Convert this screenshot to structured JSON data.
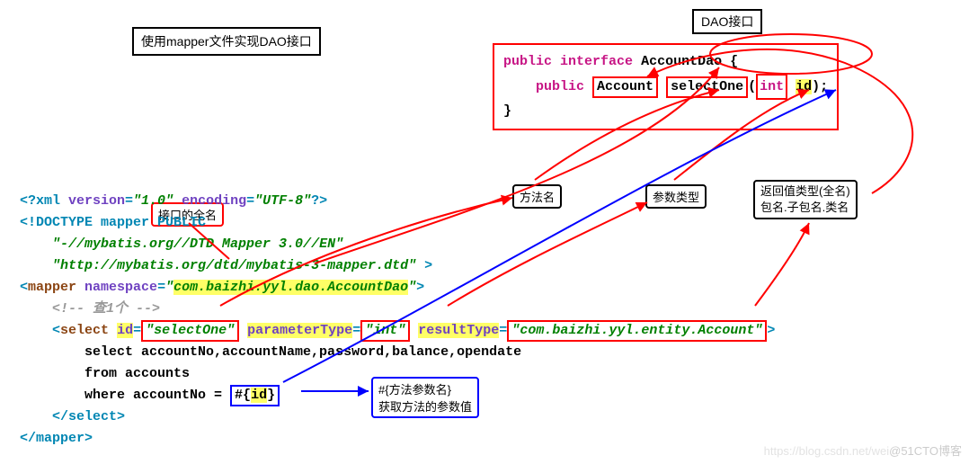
{
  "labels": {
    "top_title": "使用mapper文件实现DAO接口",
    "dao_title": "DAO接口",
    "callout_iface": "接口的全名",
    "callout_method": "方法名",
    "callout_param": "参数类型",
    "callout_ret_l1": "返回值类型(全名)",
    "callout_ret_l2": "包名.子包名.类名",
    "callout_hash_l1": "#{方法参数名}",
    "callout_hash_l2": "获取方法的参数值"
  },
  "java": {
    "public": "public",
    "interface": "interface",
    "class_name": "AccountDao",
    "brace_open": "{",
    "return_type": "Account",
    "method_name": "selectOne",
    "param_type": "int",
    "param_name": "id",
    "brace_close": "}"
  },
  "xml": {
    "decl_version_attr": "version",
    "decl_version_val": "\"1.0\"",
    "decl_enc_attr": "encoding",
    "decl_enc_val": "\"UTF-8\"",
    "doctype_name": "mapper",
    "doctype_scraps": "PUBLIC",
    "doctype_l2": "\"-//mybatis.org//DTD Mapper 3.0//EN\"",
    "doctype_l3": "\"http://mybatis.org/dtd/mybatis-3-mapper.dtd\"",
    "mapper_tag": "mapper",
    "ns_attr": "namespace",
    "ns_val": "com.baizhi.yyl.dao.AccountDao",
    "comment": "<!-- 查1个 -->",
    "select_tag": "select",
    "id_attr": "id",
    "id_val": "selectOne",
    "pt_attr": "parameterType",
    "pt_val": "int",
    "rt_attr": "resultType",
    "rt_val": "com.baizhi.yyl.entity.Account",
    "sql_l1": "select accountNo,accountName,password,balance,opendate",
    "sql_l2": "from accounts",
    "sql_l3_pre": "where accountNo = ",
    "sql_param": "#{id}",
    "select_close": "</select>",
    "mapper_close": "</mapper>"
  },
  "watermark": {
    "left": "https://blog.csdn.net/wei",
    "right": "@51CTO博客"
  }
}
